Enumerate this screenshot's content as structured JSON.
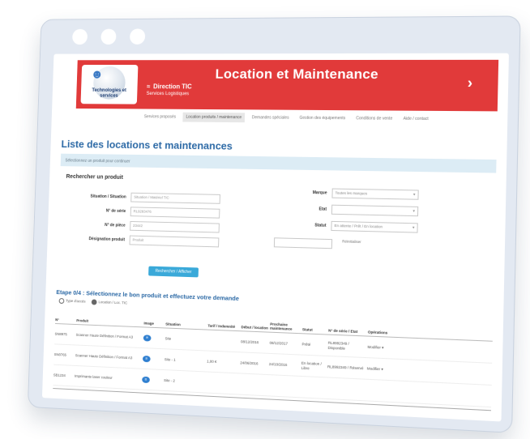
{
  "header": {
    "title": "Location et Maintenance",
    "logo_text": "Technologies et services",
    "brand_line1": "Direction TIC",
    "brand_line2": "Services Logistiques",
    "next_symbol": "›"
  },
  "nav": {
    "tabs": [
      {
        "label": "Services proposés"
      },
      {
        "label": "Location produits / maintenance",
        "active": true
      },
      {
        "label": "Demandes spéciales"
      },
      {
        "label": "Gestion des équipements"
      },
      {
        "label": "Conditions de vente"
      },
      {
        "label": "Aide / contact"
      }
    ]
  },
  "page": {
    "title": "Liste des locations et maintenances",
    "info_text": "Sélectionnez un produit pour continuer"
  },
  "search": {
    "heading": "Rechercher un produit",
    "left_fields": [
      {
        "label": "Situation / Situation",
        "value": "Situation / Matériel TIC"
      },
      {
        "label": "N° de série",
        "value": "RL9283476"
      },
      {
        "label": "N° de pièce",
        "value": "23442"
      },
      {
        "label": "Désignation produit",
        "value": "Produit"
      }
    ],
    "right_fields": [
      {
        "label": "Marque",
        "value": "Toutes les marques"
      },
      {
        "label": "Etat",
        "value": ""
      },
      {
        "label": "Statut",
        "value": "En attente / Prêt / En location"
      }
    ],
    "right_action": "Réinitialiser",
    "search_button": "Rechercher / Afficher"
  },
  "step": {
    "title": "Etape 0/4 : Sélectionnez le bon produit et effectuez votre demande",
    "options": [
      {
        "label": "Type d'accès",
        "selected": false
      },
      {
        "label": "Location / Loc. TIC",
        "selected": true
      }
    ]
  },
  "table": {
    "headers": [
      "N°",
      "Produit",
      "Image",
      "Situation",
      "Tarif / Indemnité",
      "Début / location",
      "Prochaine maintenance",
      "Statut",
      "N° de série / Etat",
      "Opérations"
    ],
    "rows": [
      {
        "num": "SN8975",
        "product": "Scanner Haute Définition / Format A3",
        "image": "doc",
        "situation": "Site",
        "tarif": "",
        "debut": "08/12/2016",
        "prochaine": "08/12/2017",
        "statut": "Prêté",
        "serie": "RL8992349 / Disponible",
        "operation": "Modifier ▾"
      },
      {
        "num": "SN0765",
        "product": "Scanner Haute Définition / Format A3",
        "image": "doc",
        "situation": "Site - 1",
        "tarif": "1,00 €",
        "debut": "24/06/2016",
        "prochaine": "24/10/2016",
        "statut": "En location / Libre",
        "serie": "RL8992349 / Réservé",
        "operation": "Modifier ▾"
      },
      {
        "num": "SB1234",
        "product": "Imprimante laser couleur",
        "image": "doc",
        "situation": "Site - 2",
        "tarif": "",
        "debut": "",
        "prochaine": "",
        "statut": "",
        "serie": "",
        "operation": ""
      }
    ]
  },
  "colors": {
    "header_red": "#e13a3a",
    "title_blue": "#2d6aa6",
    "button_blue": "#3aa9d9",
    "info_bg": "#dcecf5"
  }
}
